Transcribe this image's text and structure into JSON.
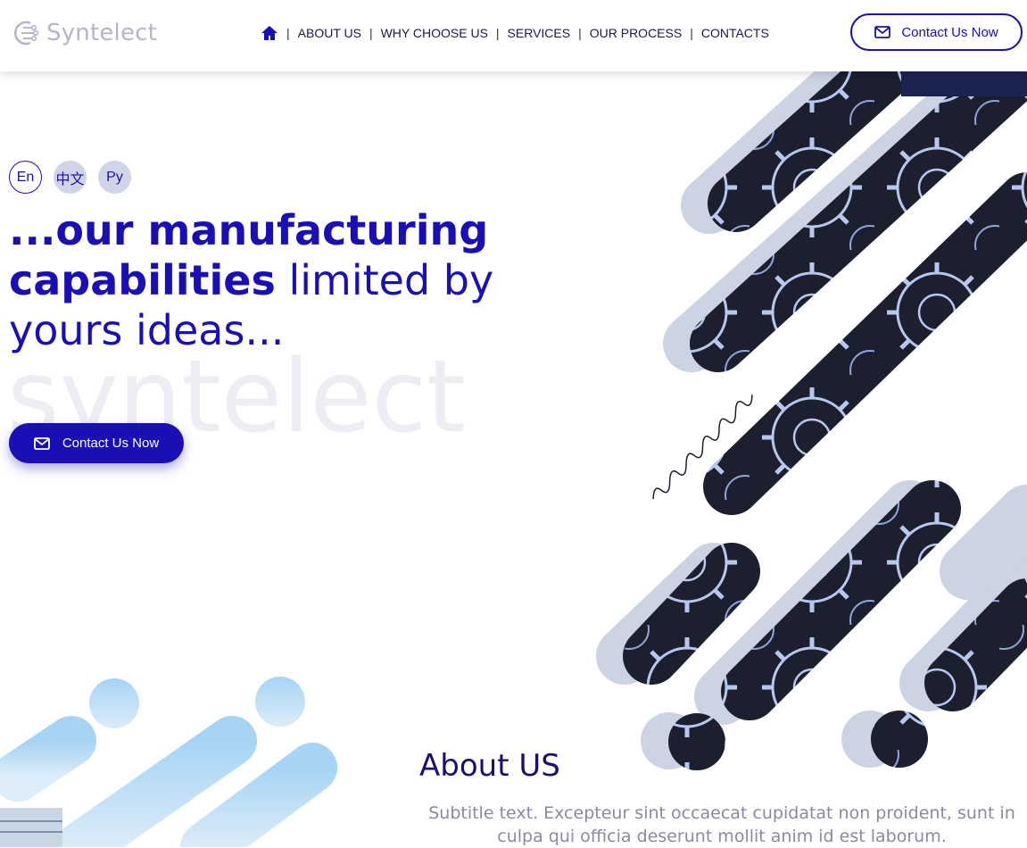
{
  "brand": {
    "name": "Syntelect",
    "accent": "#1a0fb5",
    "logo_color": "#b5b5c8"
  },
  "nav": {
    "home_icon": "home-icon",
    "items": [
      "ABOUT US",
      "WHY CHOOSE US",
      "SERVICES",
      "OUR PROCESS",
      "CONTACTS"
    ]
  },
  "header": {
    "contact_label": "Contact Us Now",
    "contact_icon": "envelope-icon"
  },
  "languages": [
    {
      "label": "En",
      "active": true
    },
    {
      "label": "中文",
      "active": false
    },
    {
      "label": "Py",
      "active": false
    }
  ],
  "hero": {
    "title_bold": "...our manufacturing capabilities",
    "title_rest": " limited by yours ideas...",
    "watermark": "syntelect",
    "cta_label": "Contact Us Now",
    "cta_icon": "envelope-icon"
  },
  "about": {
    "title": "About US",
    "subtitle": "Subtitle text. Excepteur sint occaecat cupidatat non proident, sunt in culpa qui officia deserunt mollit anim id est laborum."
  }
}
